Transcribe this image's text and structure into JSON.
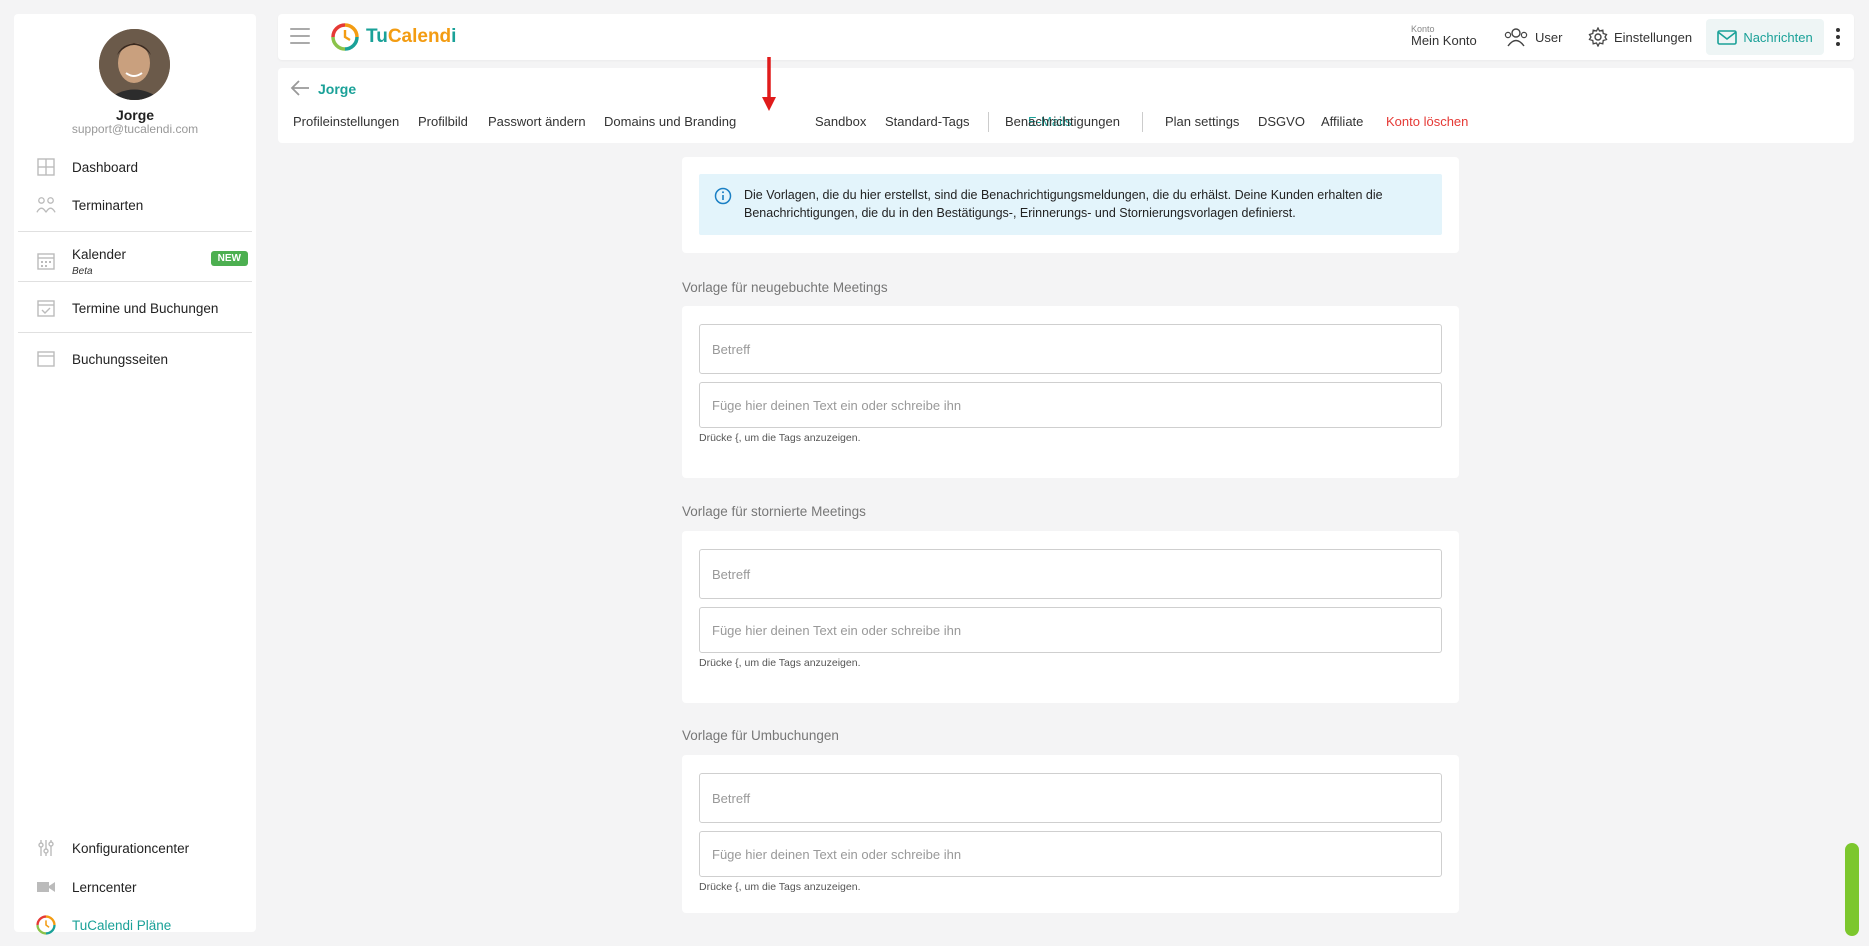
{
  "sidebar": {
    "user_name": "Jorge",
    "user_email": "support@tucalendi.com",
    "items": [
      {
        "label": "Dashboard",
        "icon": "grid-icon"
      },
      {
        "label": "Terminarten",
        "icon": "people-icon"
      },
      {
        "label": "Kalender",
        "sub": "Beta",
        "badge": "NEW",
        "icon": "calendar-icon"
      },
      {
        "label": "Termine und Buchungen",
        "icon": "calendar-check-icon"
      },
      {
        "label": "Buchungsseiten",
        "icon": "browser-window-icon"
      }
    ],
    "bottom_items": [
      {
        "label": "Konfigurationcenter",
        "icon": "sliders-icon"
      },
      {
        "label": "Lerncenter",
        "icon": "video-camera-icon"
      },
      {
        "label": "TuCalendi Pläne",
        "icon": "tucalendi-logo-icon"
      }
    ]
  },
  "topbar": {
    "logo_tu": "Tu",
    "logo_calend": "Calend",
    "logo_i": "i",
    "konto_small": "Konto",
    "konto_main": "Mein Konto",
    "user_label": "User",
    "settings_label": "Einstellungen",
    "messages_label": "Nachrichten"
  },
  "subheader": {
    "profile_name": "Jorge",
    "tabs": [
      "Profileinstellungen",
      "Profilbild",
      "Passwort ändern",
      "Domains und Branding",
      "E-Mails",
      "Sandbox",
      "Standard-Tags",
      "Benachrichtigungen",
      "Plan settings",
      "DSGVO",
      "Affiliate",
      "Konto löschen"
    ],
    "active_tab": "E-Mails"
  },
  "info": {
    "text": "Die Vorlagen, die du hier erstellst, sind die Benachrichtigungsmeldungen, die du erhälst. Deine Kunden erhalten die Benachrichtigungen, die du in den Bestätigungs-, Erinnerungs- und Stornierungsvorlagen definierst."
  },
  "templates": [
    {
      "title": "Vorlage für neugebuchte Meetings",
      "subject_placeholder": "Betreff",
      "body_placeholder": "Füge hier deinen Text ein oder schreibe ihn",
      "hint": "Drücke {, um die Tags anzuzeigen."
    },
    {
      "title": "Vorlage für stornierte Meetings",
      "subject_placeholder": "Betreff",
      "body_placeholder": "Füge hier deinen Text ein oder schreibe ihn",
      "hint": "Drücke {, um die Tags anzuzeigen."
    },
    {
      "title": "Vorlage für Umbuchungen",
      "subject_placeholder": "Betreff",
      "body_placeholder": "Füge hier deinen Text ein oder schreibe ihn",
      "hint": "Drücke {, um die Tags anzuzeigen."
    }
  ],
  "colors": {
    "brand_teal": "#1aa198",
    "brand_orange": "#f39c12",
    "danger": "#e53935",
    "badge_green": "#4caf50",
    "info_bg": "#e3f4fb"
  }
}
